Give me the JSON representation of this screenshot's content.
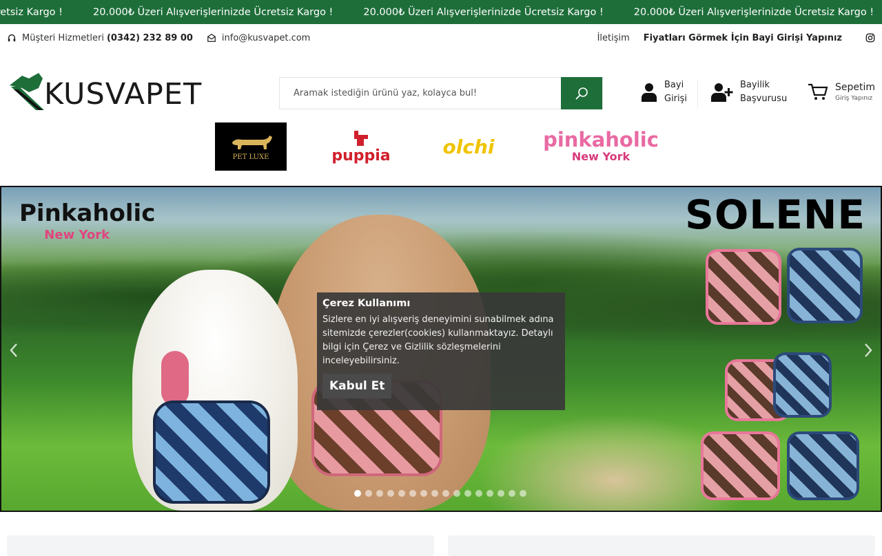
{
  "ticker": {
    "items": [
      "Ücretsiz Kargo !",
      "20.000₺ Üzeri Alışverişlerinizde Ücretsiz Kargo !",
      "20.000₺ Üzeri Alışverişlerinizde Ücretsiz Kargo !",
      "20.000₺ Üzeri Alışverişlerinizde Ücretsiz Kargo !"
    ]
  },
  "topbar": {
    "phone_label": "Müşteri Hizmetleri",
    "phone_number": "(0342) 232 89 00",
    "email": "info@kusvapet.com",
    "contact_link": "İletişim",
    "dealer_note": "Fiyatları Görmek İçin Bayi Girişi Yapınız",
    "icons": {
      "phone": "headset-icon",
      "email": "envelope-icon",
      "social": "instagram-icon"
    }
  },
  "logo": {
    "text": "KUSVAPET"
  },
  "search": {
    "placeholder": "Aramak istediğin ürünü yaz, kolayca bul!",
    "button_icon": "search-icon"
  },
  "header_actions": {
    "login_line1": "Bayi",
    "login_line2": "Girişi",
    "apply_line1": "Bayilik",
    "apply_line2": "Başvurusu",
    "cart_title": "Sepetim",
    "cart_sub": "Giriş Yapınız"
  },
  "brands": {
    "petluxe": "PET LUXE",
    "puppia": "puppia",
    "olchi": "olchi",
    "pinkaholic": "pinkaholic",
    "pinkaholic_sub": "New York"
  },
  "slider": {
    "brand": "Pinkaholic",
    "brand_sub": "New York",
    "title": "SOLENE",
    "total_slides": 16,
    "active_slide": 1
  },
  "cookie": {
    "title": "Çerez Kullanımı",
    "text": "Sizlere en iyi alışveriş deneyimini sunabilmek adına sitemizde çerezler(cookies) kullanmaktayız. Detaylı bilgi için Çerez ve Gizlilik sözleşmelerini inceleyebilirsiniz.",
    "accept": "Kabul Et"
  },
  "colors": {
    "brand_green": "#1e6e3a",
    "cookie_bg": "#383838"
  }
}
